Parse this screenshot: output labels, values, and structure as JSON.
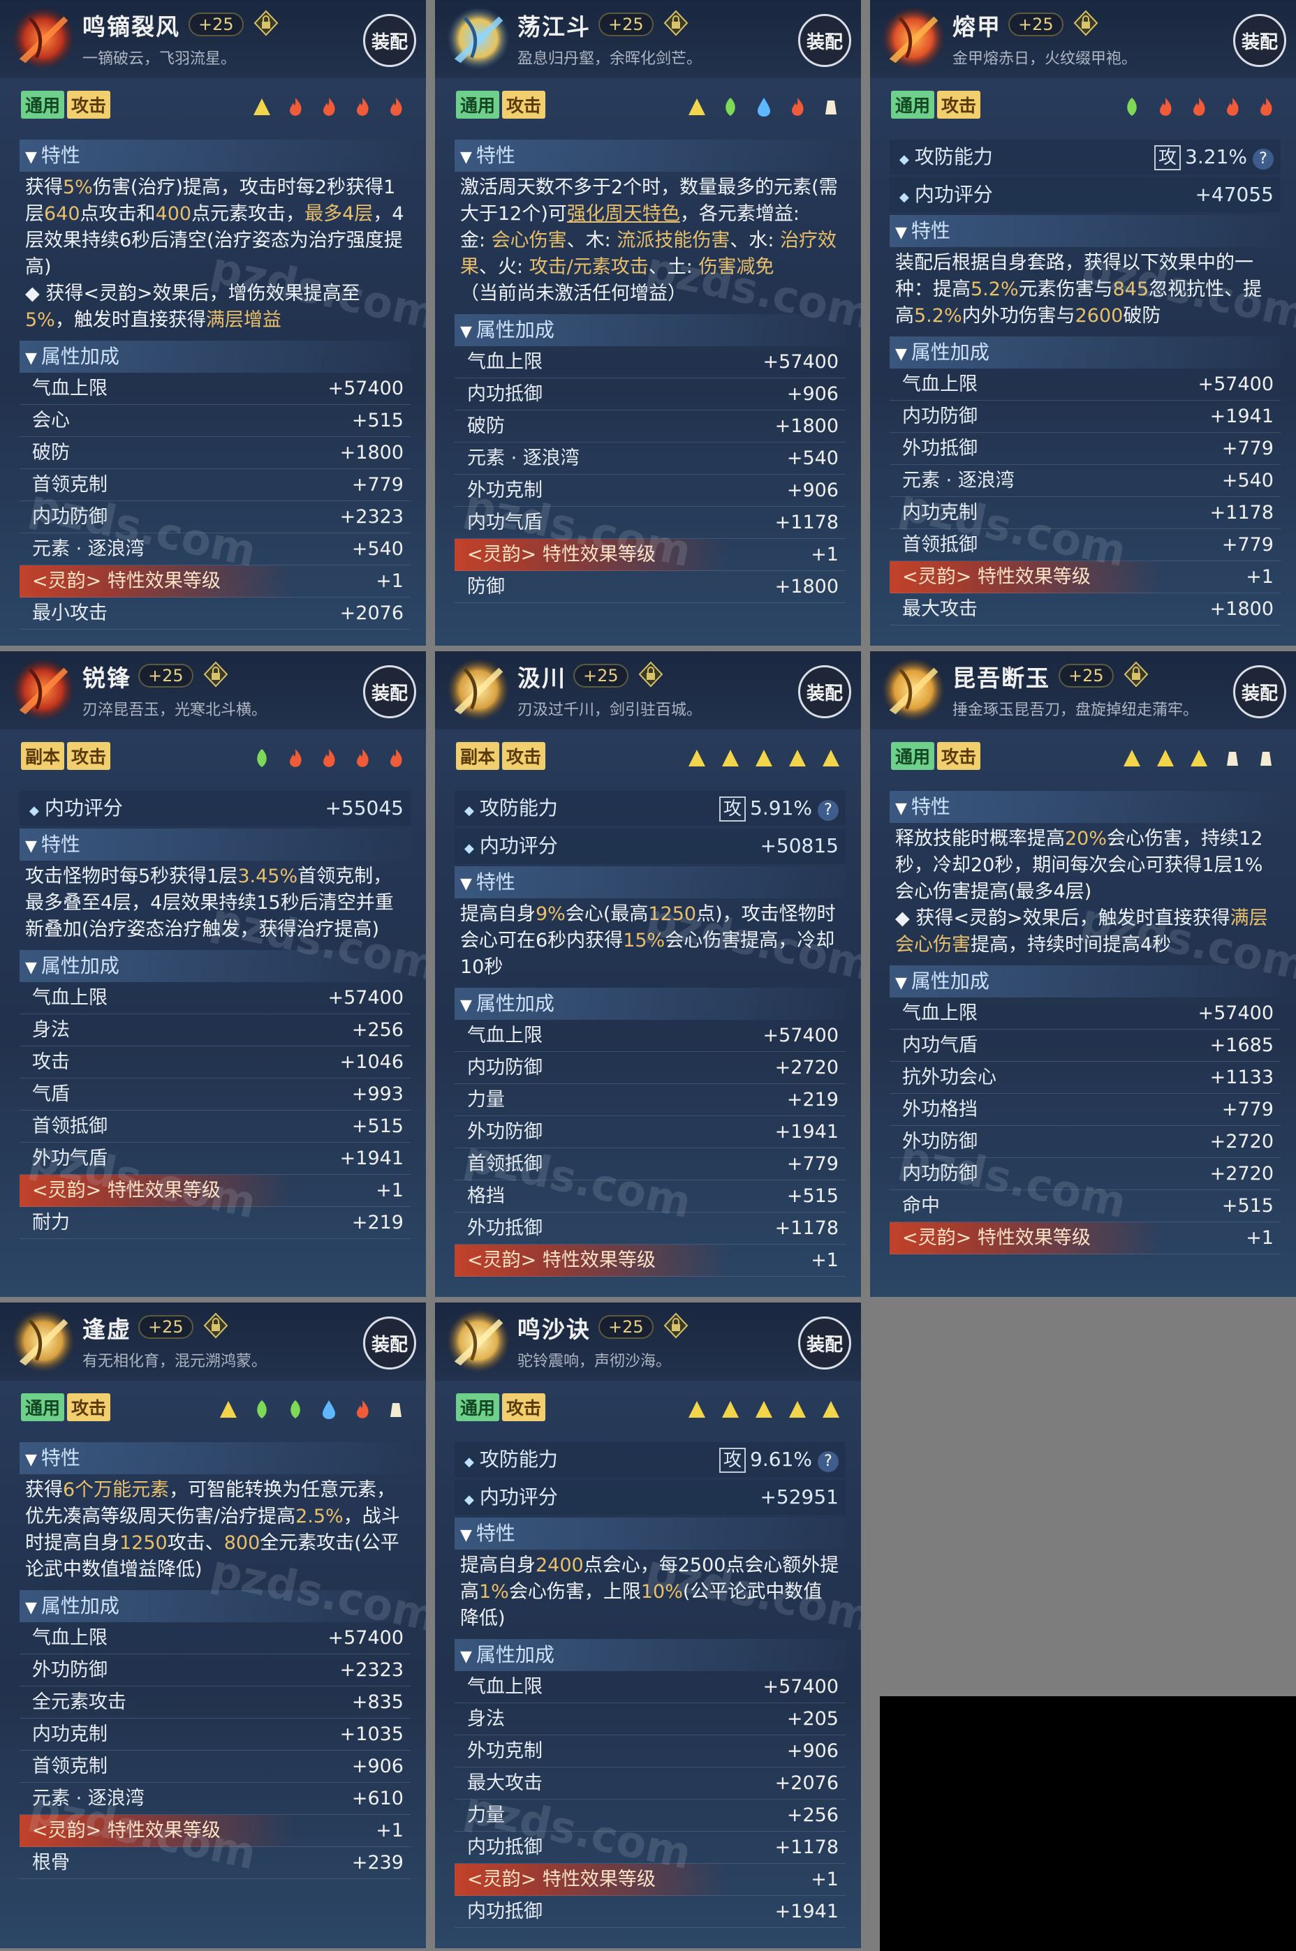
{
  "common": {
    "equip_label": "装配",
    "tag_general": "通用",
    "tag_dungeon": "副本",
    "tag_attack": "攻击",
    "trait_header": "特性",
    "attr_header": "属性加成",
    "watermark": "pzds.com",
    "atk_box": "攻",
    "ling_label": "<灵韵>",
    "ling_rest": " 特性效果等级",
    "colors": {
      "accent_gold": "#e9bf6a",
      "tag_green": "#6fd08b",
      "tag_gold": "#f1cf6e",
      "ling_red": "#c2422a"
    }
  },
  "cards": [
    {
      "name": "鸣镝裂风",
      "level": "+25",
      "flavor": "一镝破云，飞羽流星。",
      "tag": "通用",
      "elements": [
        "earth",
        "fire",
        "fire",
        "fire",
        "fire"
      ],
      "emblem": "red-blade",
      "trait_html": "获得<span class='hl'>5%</span>伤害(治疗)提高，攻击时每2秒获得1层<span class='hl'>640</span>点攻击和<span class='hl'>400</span>点元素攻击，<span class='hl'>最多4层</span>，4层效果持续6秒后清空(治疗姿态为治疗强度提高)<br>◆ 获得<灵韵>效果后，增伤效果提高至<span class='hl'>5%</span>，触发时直接获得<span class='hl'>满层增益</span>",
      "stats": [],
      "attrs": [
        {
          "k": "气血上限",
          "v": "+57400"
        },
        {
          "k": "会心",
          "v": "+515"
        },
        {
          "k": "破防",
          "v": "+1800"
        },
        {
          "k": "首领克制",
          "v": "+779"
        },
        {
          "k": "内功防御",
          "v": "+2323"
        },
        {
          "k": "元素 · 逐浪湾",
          "v": "+540"
        },
        {
          "k": "LING",
          "v": "+1"
        },
        {
          "k": "最小攻击",
          "v": "+2076"
        }
      ]
    },
    {
      "name": "荡江斗",
      "level": "+25",
      "flavor": "盈息归丹壑，余晖化剑芒。",
      "tag": "通用",
      "elements": [
        "earth",
        "wood",
        "water",
        "fire",
        "metal"
      ],
      "emblem": "orbs",
      "trait_html": "激活周天数不多于2个时，数量最多的元素(需大于12个)可<span class='hlu'>强化周天特色</span>，各元素增益:<br>金: <span class='hl'>会心伤害</span>、木: <span class='hl'>流派技能伤害</span>、水: <span class='hl'>治疗效果</span>、火: <span class='hl'>攻击/元素攻击</span>、土: <span class='hl'>伤害减免</span><br>（当前尚未激活任何增益）",
      "stats": [],
      "attrs": [
        {
          "k": "气血上限",
          "v": "+57400"
        },
        {
          "k": "内功抵御",
          "v": "+906"
        },
        {
          "k": "破防",
          "v": "+1800"
        },
        {
          "k": "元素 · 逐浪湾",
          "v": "+540"
        },
        {
          "k": "外功克制",
          "v": "+906"
        },
        {
          "k": "内功气盾",
          "v": "+1178"
        },
        {
          "k": "LING",
          "v": "+1"
        },
        {
          "k": "防御",
          "v": "+1800"
        }
      ]
    },
    {
      "name": "熔甲",
      "level": "+25",
      "flavor": "金甲熔赤日，火纹缀甲袍。",
      "tag": "通用",
      "elements": [
        "wood",
        "fire",
        "fire",
        "fire",
        "fire"
      ],
      "emblem": "fire-orb",
      "trait_html": "装配后根据自身套路，获得以下效果中的一种：提高<span class='hl'>5.2%</span>元素伤害与<span class='hl'>845</span>忽视抗性、提高<span class='hl'>5.2%</span>内外功伤害与<span class='hl'>2600</span>破防",
      "stats": [
        {
          "k": "攻防能力",
          "v": "3.21%",
          "box": true
        },
        {
          "k": "内功评分",
          "v": "+47055"
        }
      ],
      "attrs": [
        {
          "k": "气血上限",
          "v": "+57400"
        },
        {
          "k": "内功防御",
          "v": "+1941"
        },
        {
          "k": "外功抵御",
          "v": "+779"
        },
        {
          "k": "元素 · 逐浪湾",
          "v": "+540"
        },
        {
          "k": "内功克制",
          "v": "+1178"
        },
        {
          "k": "首领抵御",
          "v": "+779"
        },
        {
          "k": "LING",
          "v": "+1"
        },
        {
          "k": "最大攻击",
          "v": "+1800"
        }
      ]
    },
    {
      "name": "锐锋",
      "level": "+25",
      "flavor": "刃淬昆吾玉，光寒北斗横。",
      "tag": "副本",
      "elements": [
        "wood",
        "fire",
        "fire",
        "fire",
        "fire"
      ],
      "emblem": "red-blade",
      "trait_html": "攻击怪物时每5秒获得1层<span class='hl'>3.45%</span>首领克制，最多叠至4层，4层效果持续15秒后清空并重新叠加(治疗姿态治疗触发，获得治疗提高)",
      "stats": [
        {
          "k": "内功评分",
          "v": "+55045"
        }
      ],
      "attrs": [
        {
          "k": "气血上限",
          "v": "+57400"
        },
        {
          "k": "身法",
          "v": "+256"
        },
        {
          "k": "攻击",
          "v": "+1046"
        },
        {
          "k": "气盾",
          "v": "+993"
        },
        {
          "k": "首领抵御",
          "v": "+515"
        },
        {
          "k": "外功气盾",
          "v": "+1941"
        },
        {
          "k": "LING",
          "v": "+1"
        },
        {
          "k": "耐力",
          "v": "+219"
        }
      ]
    },
    {
      "name": "汲川",
      "level": "+25",
      "flavor": "刃汲过千川，剑引驻百城。",
      "tag": "副本",
      "elements": [
        "earth",
        "earth",
        "earth",
        "earth",
        "earth"
      ],
      "emblem": "gold-swirl",
      "trait_html": "提高自身<span class='hl'>9%</span>会心(最高<span class='hl'>1250</span>点)，攻击怪物时会心可在6秒内获得<span class='hl'>15%</span>会心伤害提高，冷却10秒",
      "stats": [
        {
          "k": "攻防能力",
          "v": "5.91%",
          "box": true
        },
        {
          "k": "内功评分",
          "v": "+50815"
        }
      ],
      "attrs": [
        {
          "k": "气血上限",
          "v": "+57400"
        },
        {
          "k": "内功防御",
          "v": "+2720"
        },
        {
          "k": "力量",
          "v": "+219"
        },
        {
          "k": "外功防御",
          "v": "+1941"
        },
        {
          "k": "首领抵御",
          "v": "+779"
        },
        {
          "k": "格挡",
          "v": "+515"
        },
        {
          "k": "外功抵御",
          "v": "+1178"
        },
        {
          "k": "LING",
          "v": "+1"
        }
      ]
    },
    {
      "name": "昆吾断玉",
      "level": "+25",
      "flavor": "捶金琢玉昆吾刀，盘旋掉纽走蒲牢。",
      "tag": "通用",
      "elements": [
        "earth",
        "earth",
        "earth",
        "metal",
        "metal"
      ],
      "emblem": "gold-blade",
      "trait_html": "释放技能时概率提高<span class='hl'>20%</span>会心伤害，持续12秒，冷却20秒，期间每次会心可获得1层1%会心伤害提高(最多4层)<br>◆ 获得<灵韵>效果后，触发时直接获得<span class='hl'>满层会心伤害</span>提高，持续时间提高4秒",
      "stats": [],
      "attrs": [
        {
          "k": "气血上限",
          "v": "+57400"
        },
        {
          "k": "内功气盾",
          "v": "+1685"
        },
        {
          "k": "抗外功会心",
          "v": "+1133"
        },
        {
          "k": "外功格挡",
          "v": "+779"
        },
        {
          "k": "外功防御",
          "v": "+2720"
        },
        {
          "k": "内功防御",
          "v": "+2720"
        },
        {
          "k": "命中",
          "v": "+515"
        },
        {
          "k": "LING",
          "v": "+1"
        }
      ]
    },
    {
      "name": "逢虚",
      "level": "+25",
      "flavor": "有无相化育，混元溯鸿蒙。",
      "tag": "通用",
      "elements": [
        "earth",
        "wood",
        "wood",
        "water",
        "fire",
        "metal"
      ],
      "emblem": "gold-swirl",
      "trait_html": "获得<span class='hl'>6个万能元素</span>，可智能转换为任意元素，优先凑高等级周天伤害/治疗提高<span class='hl'>2.5%</span>，战斗时提高自身<span class='hl'>1250</span>攻击、<span class='hl'>800</span>全元素攻击(公平论武中数值增益降低)",
      "stats": [],
      "attrs": [
        {
          "k": "气血上限",
          "v": "+57400"
        },
        {
          "k": "外功防御",
          "v": "+2323"
        },
        {
          "k": "全元素攻击",
          "v": "+835"
        },
        {
          "k": "内功克制",
          "v": "+1035"
        },
        {
          "k": "首领克制",
          "v": "+906"
        },
        {
          "k": "元素 · 逐浪湾",
          "v": "+610"
        },
        {
          "k": "LING",
          "v": "+1"
        },
        {
          "k": "根骨",
          "v": "+239"
        }
      ]
    },
    {
      "name": "鸣沙诀",
      "level": "+25",
      "flavor": "驼铃震响，声彻沙海。",
      "tag": "通用",
      "elements": [
        "earth",
        "earth",
        "earth",
        "earth",
        "earth"
      ],
      "emblem": "gold-bell",
      "trait_html": "提高自身<span class='hl'>2400</span>点会心，每2500点会心额外提高<span class='hl'>1%</span>会心伤害，上限<span class='hl'>10%</span>(公平论武中数值降低)",
      "stats": [
        {
          "k": "攻防能力",
          "v": "9.61%",
          "box": true
        },
        {
          "k": "内功评分",
          "v": "+52951"
        }
      ],
      "attrs": [
        {
          "k": "气血上限",
          "v": "+57400"
        },
        {
          "k": "身法",
          "v": "+205"
        },
        {
          "k": "外功克制",
          "v": "+906"
        },
        {
          "k": "最大攻击",
          "v": "+2076"
        },
        {
          "k": "力量",
          "v": "+256"
        },
        {
          "k": "内功抵御",
          "v": "+1178"
        },
        {
          "k": "LING",
          "v": "+1"
        },
        {
          "k": "内功抵御",
          "v": "+1941"
        }
      ]
    }
  ]
}
